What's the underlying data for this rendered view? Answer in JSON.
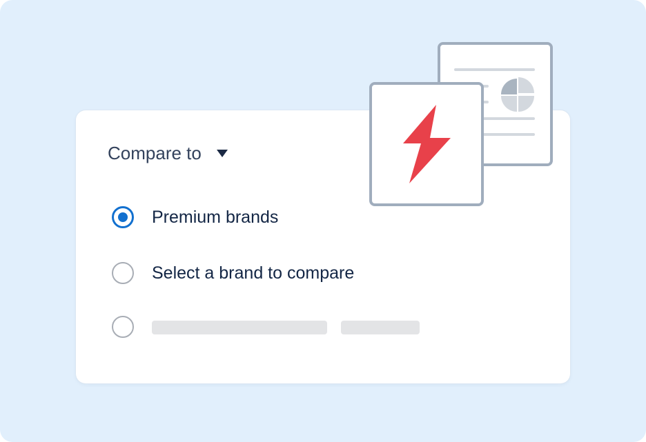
{
  "compare": {
    "label": "Compare to",
    "caret_icon": "caret-down-icon"
  },
  "options": [
    {
      "label": "Premium brands",
      "selected": true
    },
    {
      "label": "Select a brand to compare",
      "selected": false
    },
    {
      "label": "",
      "selected": false
    }
  ],
  "illustration": {
    "icons": [
      "document-chart-icon",
      "lightning-bolt-icon"
    ]
  },
  "colors": {
    "background": "#e1effc",
    "accent": "#1270cf",
    "bolt": "#e8414a",
    "frame": "#a0adbd"
  }
}
